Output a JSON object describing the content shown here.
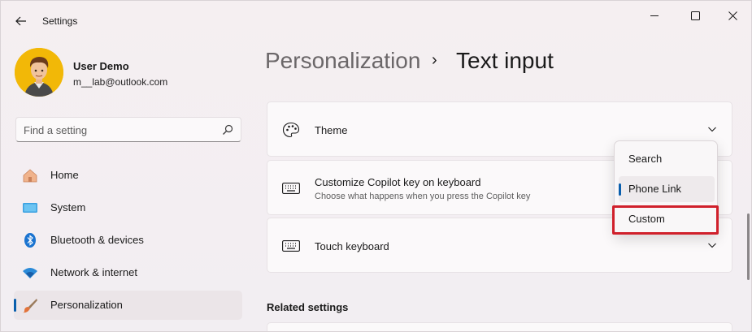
{
  "app": {
    "title": "Settings"
  },
  "user": {
    "name": "User Demo",
    "email": "m__lab@outlook.com"
  },
  "search": {
    "placeholder": "Find a setting"
  },
  "nav": {
    "items": [
      {
        "label": "Home",
        "icon": "home-icon"
      },
      {
        "label": "System",
        "icon": "system-icon"
      },
      {
        "label": "Bluetooth & devices",
        "icon": "bluetooth-icon"
      },
      {
        "label": "Network & internet",
        "icon": "wifi-icon"
      },
      {
        "label": "Personalization",
        "icon": "brush-icon",
        "active": true
      }
    ]
  },
  "breadcrumb": {
    "parent": "Personalization",
    "separator": "›",
    "current": "Text input"
  },
  "cards": [
    {
      "title": "Theme",
      "icon": "palette-icon"
    },
    {
      "title": "Customize Copilot key on keyboard",
      "subtitle": "Choose what happens when you press the Copilot key",
      "icon": "keyboard-icon"
    },
    {
      "title": "Touch keyboard",
      "icon": "keyboard-icon"
    }
  ],
  "related": {
    "heading": "Related settings"
  },
  "dropdown": {
    "options": [
      "Search",
      "Phone Link",
      "Custom"
    ],
    "selected": "Phone Link",
    "highlighted": "Custom"
  },
  "colors": {
    "accent": "#0a5fad",
    "highlight": "#d0202b"
  }
}
